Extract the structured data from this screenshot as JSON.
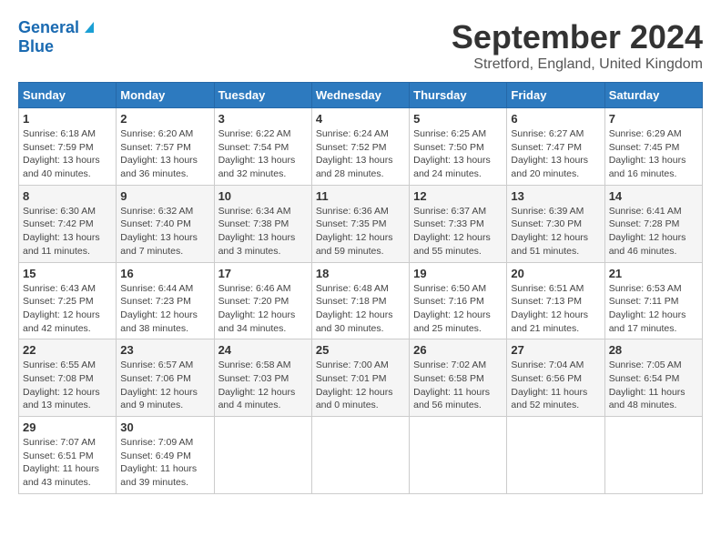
{
  "header": {
    "logo_line1": "General",
    "logo_line2": "Blue",
    "title": "September 2024",
    "subtitle": "Stretford, England, United Kingdom"
  },
  "calendar": {
    "headers": [
      "Sunday",
      "Monday",
      "Tuesday",
      "Wednesday",
      "Thursday",
      "Friday",
      "Saturday"
    ],
    "weeks": [
      [
        {
          "day": "1",
          "info": "Sunrise: 6:18 AM\nSunset: 7:59 PM\nDaylight: 13 hours\nand 40 minutes."
        },
        {
          "day": "2",
          "info": "Sunrise: 6:20 AM\nSunset: 7:57 PM\nDaylight: 13 hours\nand 36 minutes."
        },
        {
          "day": "3",
          "info": "Sunrise: 6:22 AM\nSunset: 7:54 PM\nDaylight: 13 hours\nand 32 minutes."
        },
        {
          "day": "4",
          "info": "Sunrise: 6:24 AM\nSunset: 7:52 PM\nDaylight: 13 hours\nand 28 minutes."
        },
        {
          "day": "5",
          "info": "Sunrise: 6:25 AM\nSunset: 7:50 PM\nDaylight: 13 hours\nand 24 minutes."
        },
        {
          "day": "6",
          "info": "Sunrise: 6:27 AM\nSunset: 7:47 PM\nDaylight: 13 hours\nand 20 minutes."
        },
        {
          "day": "7",
          "info": "Sunrise: 6:29 AM\nSunset: 7:45 PM\nDaylight: 13 hours\nand 16 minutes."
        }
      ],
      [
        {
          "day": "8",
          "info": "Sunrise: 6:30 AM\nSunset: 7:42 PM\nDaylight: 13 hours\nand 11 minutes."
        },
        {
          "day": "9",
          "info": "Sunrise: 6:32 AM\nSunset: 7:40 PM\nDaylight: 13 hours\nand 7 minutes."
        },
        {
          "day": "10",
          "info": "Sunrise: 6:34 AM\nSunset: 7:38 PM\nDaylight: 13 hours\nand 3 minutes."
        },
        {
          "day": "11",
          "info": "Sunrise: 6:36 AM\nSunset: 7:35 PM\nDaylight: 12 hours\nand 59 minutes."
        },
        {
          "day": "12",
          "info": "Sunrise: 6:37 AM\nSunset: 7:33 PM\nDaylight: 12 hours\nand 55 minutes."
        },
        {
          "day": "13",
          "info": "Sunrise: 6:39 AM\nSunset: 7:30 PM\nDaylight: 12 hours\nand 51 minutes."
        },
        {
          "day": "14",
          "info": "Sunrise: 6:41 AM\nSunset: 7:28 PM\nDaylight: 12 hours\nand 46 minutes."
        }
      ],
      [
        {
          "day": "15",
          "info": "Sunrise: 6:43 AM\nSunset: 7:25 PM\nDaylight: 12 hours\nand 42 minutes."
        },
        {
          "day": "16",
          "info": "Sunrise: 6:44 AM\nSunset: 7:23 PM\nDaylight: 12 hours\nand 38 minutes."
        },
        {
          "day": "17",
          "info": "Sunrise: 6:46 AM\nSunset: 7:20 PM\nDaylight: 12 hours\nand 34 minutes."
        },
        {
          "day": "18",
          "info": "Sunrise: 6:48 AM\nSunset: 7:18 PM\nDaylight: 12 hours\nand 30 minutes."
        },
        {
          "day": "19",
          "info": "Sunrise: 6:50 AM\nSunset: 7:16 PM\nDaylight: 12 hours\nand 25 minutes."
        },
        {
          "day": "20",
          "info": "Sunrise: 6:51 AM\nSunset: 7:13 PM\nDaylight: 12 hours\nand 21 minutes."
        },
        {
          "day": "21",
          "info": "Sunrise: 6:53 AM\nSunset: 7:11 PM\nDaylight: 12 hours\nand 17 minutes."
        }
      ],
      [
        {
          "day": "22",
          "info": "Sunrise: 6:55 AM\nSunset: 7:08 PM\nDaylight: 12 hours\nand 13 minutes."
        },
        {
          "day": "23",
          "info": "Sunrise: 6:57 AM\nSunset: 7:06 PM\nDaylight: 12 hours\nand 9 minutes."
        },
        {
          "day": "24",
          "info": "Sunrise: 6:58 AM\nSunset: 7:03 PM\nDaylight: 12 hours\nand 4 minutes."
        },
        {
          "day": "25",
          "info": "Sunrise: 7:00 AM\nSunset: 7:01 PM\nDaylight: 12 hours\nand 0 minutes."
        },
        {
          "day": "26",
          "info": "Sunrise: 7:02 AM\nSunset: 6:58 PM\nDaylight: 11 hours\nand 56 minutes."
        },
        {
          "day": "27",
          "info": "Sunrise: 7:04 AM\nSunset: 6:56 PM\nDaylight: 11 hours\nand 52 minutes."
        },
        {
          "day": "28",
          "info": "Sunrise: 7:05 AM\nSunset: 6:54 PM\nDaylight: 11 hours\nand 48 minutes."
        }
      ],
      [
        {
          "day": "29",
          "info": "Sunrise: 7:07 AM\nSunset: 6:51 PM\nDaylight: 11 hours\nand 43 minutes."
        },
        {
          "day": "30",
          "info": "Sunrise: 7:09 AM\nSunset: 6:49 PM\nDaylight: 11 hours\nand 39 minutes."
        },
        {
          "day": "",
          "info": ""
        },
        {
          "day": "",
          "info": ""
        },
        {
          "day": "",
          "info": ""
        },
        {
          "day": "",
          "info": ""
        },
        {
          "day": "",
          "info": ""
        }
      ]
    ]
  }
}
